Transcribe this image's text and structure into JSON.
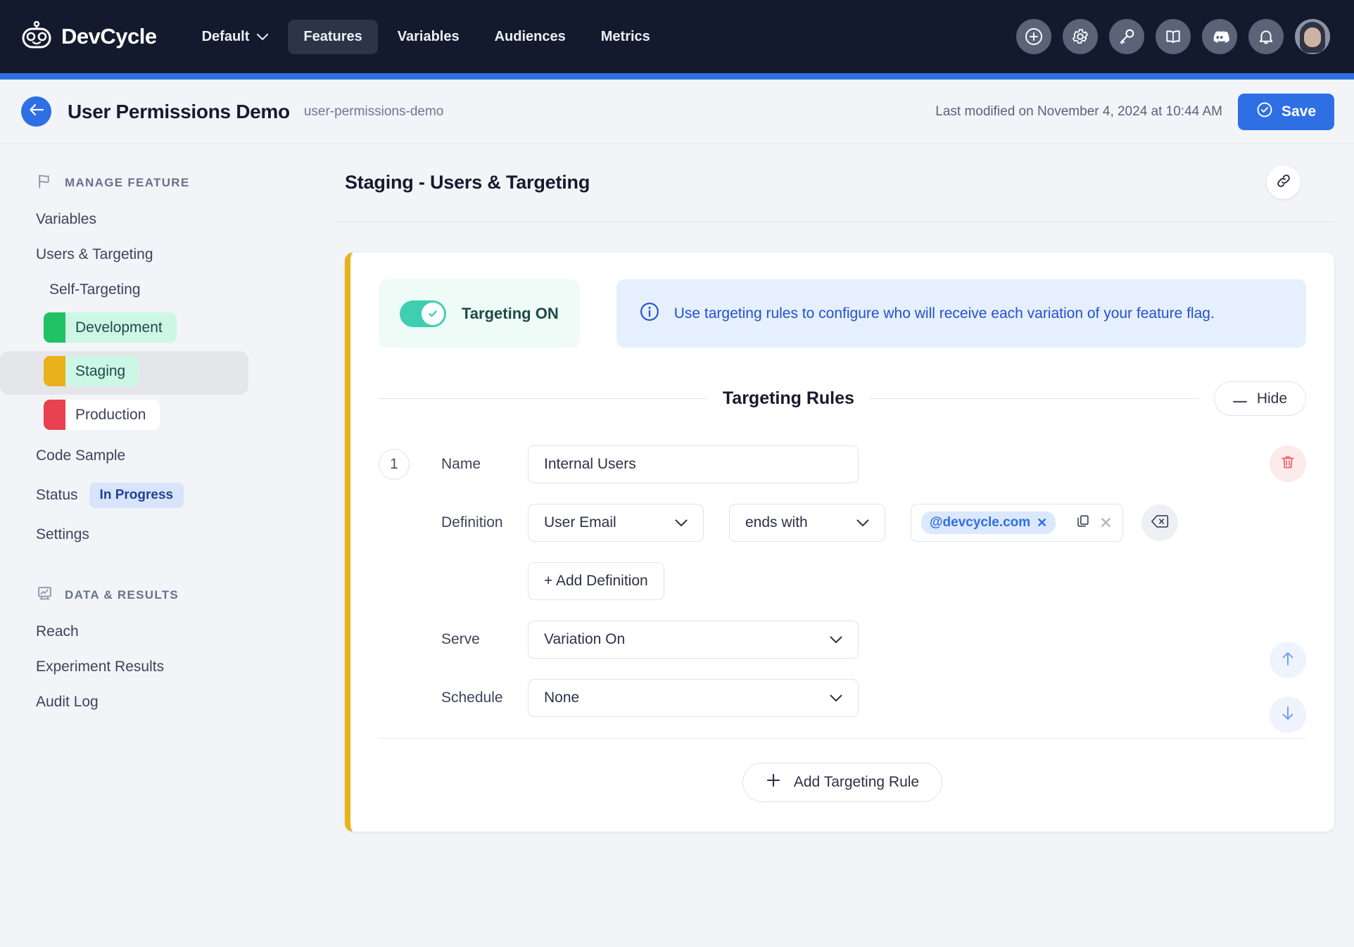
{
  "topnav": {
    "brand_name": "DevCycle",
    "brand_icon": "devcycle-robot-logo",
    "project_selector": "Default",
    "items": [
      {
        "label": "Features",
        "active": true
      },
      {
        "label": "Variables",
        "active": false
      },
      {
        "label": "Audiences",
        "active": false
      },
      {
        "label": "Metrics",
        "active": false
      }
    ],
    "right_icons": [
      "plus-circle-icon",
      "gear-icon",
      "key-icon",
      "book-icon",
      "discord-icon",
      "bell-icon"
    ],
    "avatar": "user-avatar"
  },
  "pageheader": {
    "back_icon": "arrow-left-icon",
    "title": "User Permissions Demo",
    "key": "user-permissions-demo",
    "last_modified": "Last modified on November 4, 2024 at 10:44 AM",
    "save_label": "Save",
    "save_icon": "check-circle-icon"
  },
  "sidebar": {
    "manage_section": {
      "icon": "flag-icon",
      "label": "MANAGE FEATURE"
    },
    "links": [
      {
        "label": "Variables"
      },
      {
        "label": "Users & Targeting"
      }
    ],
    "self_targeting_label": "Self-Targeting",
    "environments": [
      {
        "label": "Development",
        "color": "#21c165",
        "selected": false
      },
      {
        "label": "Staging",
        "color": "#e9b11a",
        "selected": true
      },
      {
        "label": "Production",
        "color": "#e8414f",
        "selected": false
      }
    ],
    "code_sample_label": "Code Sample",
    "status_label": "Status",
    "status_value": "In Progress",
    "settings_label": "Settings",
    "data_section": {
      "icon": "chart-board-icon",
      "label": "DATA & RESULTS"
    },
    "data_links": [
      {
        "label": "Reach"
      },
      {
        "label": "Experiment Results"
      },
      {
        "label": "Audit Log"
      }
    ]
  },
  "main": {
    "title": "Staging - Users & Targeting",
    "link_icon": "link-chain-icon",
    "targeting_toggle": {
      "label": "Targeting ON",
      "state": "on",
      "color": "#3fcfb0"
    },
    "info_banner": {
      "icon": "info-circle-icon",
      "text": "Use targeting rules to configure who will receive each variation of your feature flag."
    },
    "rules_section": {
      "title": "Targeting Rules",
      "hide_label": "Hide",
      "hide_icon": "minus-icon"
    },
    "rule": {
      "number": "1",
      "name_label": "Name",
      "name_value": "Internal Users",
      "definition_label": "Definition",
      "definition_property": "User Email",
      "definition_comparator": "ends with",
      "definition_values": [
        "@devcycle.com"
      ],
      "chip_remove_icon": "close-icon",
      "copy_icon": "copy-icon",
      "clear_icon": "close-icon",
      "delete_values_icon": "backspace-icon",
      "add_definition_label": "+ Add Definition",
      "serve_label": "Serve",
      "serve_value": "Variation On",
      "schedule_label": "Schedule",
      "schedule_value": "None",
      "delete_rule_icon": "trash-icon",
      "move_up_icon": "arrow-up-icon",
      "move_down_icon": "arrow-down-icon"
    },
    "add_rule_label": "Add Targeting Rule",
    "add_rule_icon": "plus-icon"
  },
  "colors": {
    "brand_dark": "#141a2e",
    "accent_blue": "#2f6fe4",
    "accent_teal": "#3fcfb0",
    "card_accent": "#e9b11a",
    "page_bg": "#f2f4f8"
  }
}
